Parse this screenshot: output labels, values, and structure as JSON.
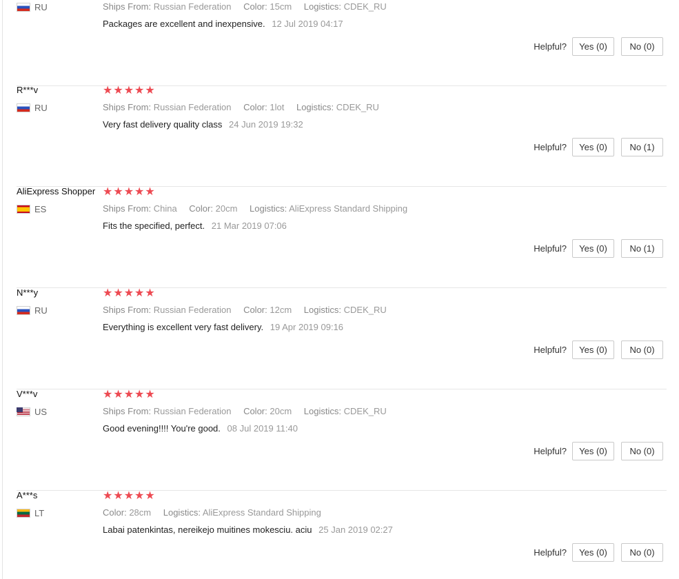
{
  "helpful_label": "Helpful?",
  "labels": {
    "ships_from": "Ships From:",
    "color": "Color:",
    "logistics": "Logistics:"
  },
  "reviews": [
    {
      "user": "",
      "country": "RU",
      "stars": "★★★★★",
      "ships_from": "Russian Federation",
      "color": "15cm",
      "logistics": "CDEK_RU",
      "text": "Packages are excellent and inexpensive.",
      "date": "12 Jul 2019 04:17",
      "yes": "Yes (0)",
      "no": "No (0)"
    },
    {
      "user": "R***v",
      "country": "RU",
      "stars": "★★★★★",
      "ships_from": "Russian Federation",
      "color": "1lot",
      "logistics": "CDEK_RU",
      "text": "Very fast delivery quality class",
      "date": "24 Jun 2019 19:32",
      "yes": "Yes (0)",
      "no": "No (1)"
    },
    {
      "user": "AliExpress Shopper",
      "country": "ES",
      "stars": "★★★★★",
      "ships_from": "China",
      "color": "20cm",
      "logistics": "AliExpress Standard Shipping",
      "text": "Fits the specified, perfect.",
      "date": "21 Mar 2019 07:06",
      "yes": "Yes (0)",
      "no": "No (1)"
    },
    {
      "user": "N***y",
      "country": "RU",
      "stars": "★★★★★",
      "ships_from": "Russian Federation",
      "color": "12cm",
      "logistics": "CDEK_RU",
      "text": "Everything is excellent very fast delivery.",
      "date": "19 Apr 2019 09:16",
      "yes": "Yes (0)",
      "no": "No (0)"
    },
    {
      "user": "V***v",
      "country": "US",
      "stars": "★★★★★",
      "ships_from": "Russian Federation",
      "color": "20cm",
      "logistics": "CDEK_RU",
      "text": "Good evening!!!! You're good.",
      "date": "08 Jul 2019 11:40",
      "yes": "Yes (0)",
      "no": "No (0)"
    },
    {
      "user": "A***s",
      "country": "LT",
      "stars": "★★★★★",
      "color": "28cm",
      "logistics": "AliExpress Standard Shipping",
      "text": "Labai patenkintas, nereikejo muitines mokesciu. aciu",
      "date": "25 Jan 2019 02:27",
      "yes": "Yes (0)",
      "no": "No (0)"
    }
  ]
}
